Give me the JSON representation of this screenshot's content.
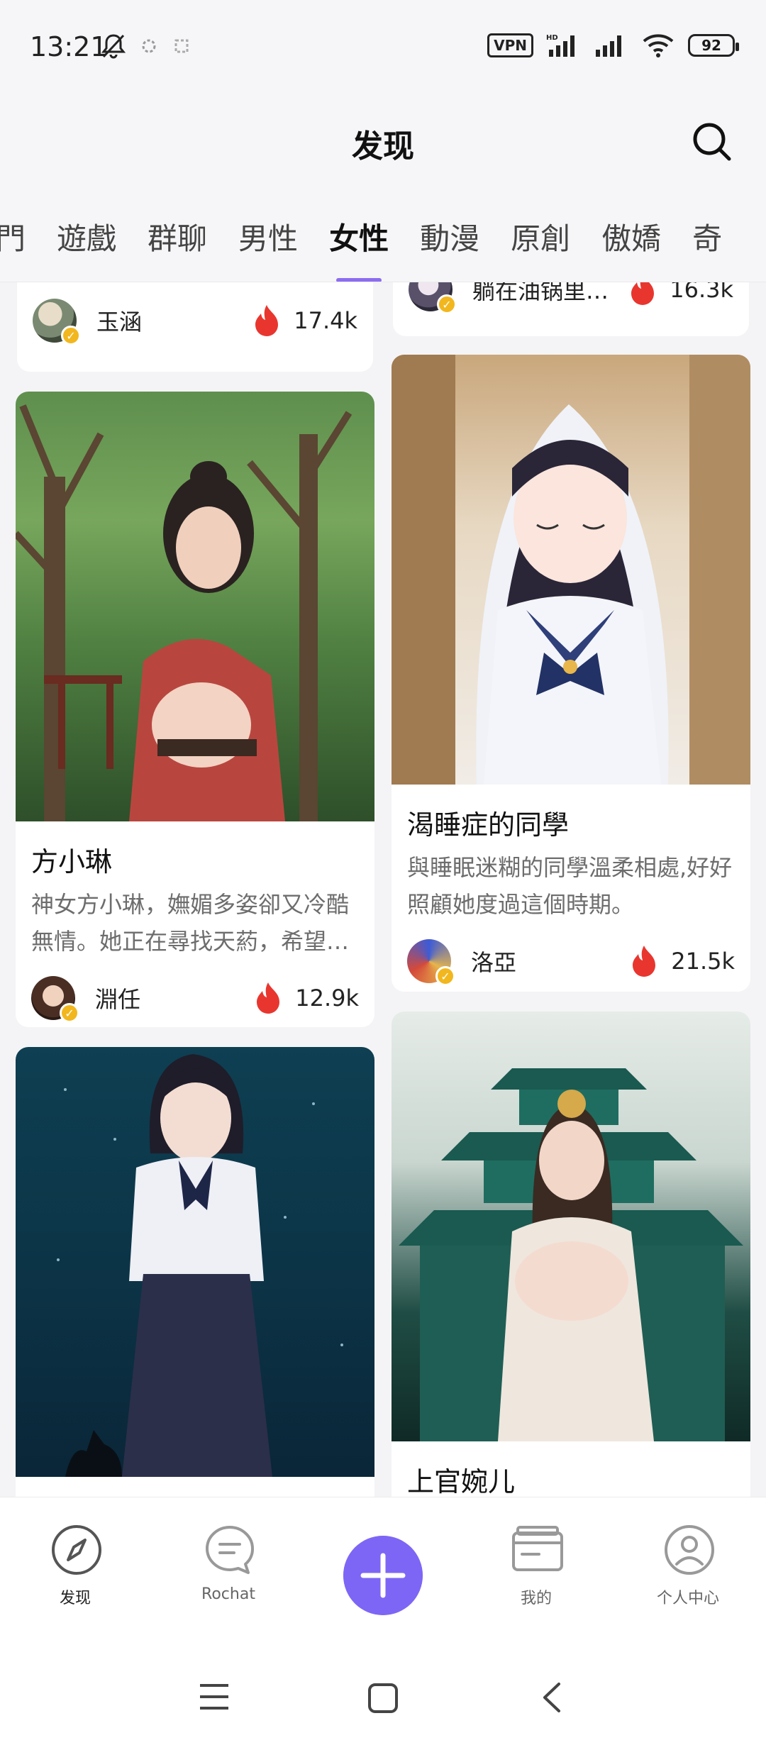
{
  "status_bar": {
    "time": "13:21",
    "vpn": "VPN",
    "battery": "92"
  },
  "header": {
    "title": "发现"
  },
  "tabs": [
    "門",
    "遊戲",
    "群聊",
    "男性",
    "女性",
    "動漫",
    "原創",
    "傲嬌",
    "奇"
  ],
  "active_tab": "女性",
  "cards": {
    "top_left": {
      "author": "玉涵",
      "likes": "17.4k"
    },
    "top_right": {
      "author": "躺在油锅里…",
      "likes": "16.3k"
    },
    "fang": {
      "title": "方小琳",
      "desc": "神女方小琳，嫵媚多姿卻又冷酷無情。她正在尋找天葯，希望…",
      "author": "淵任",
      "likes": "12.9k"
    },
    "sleepy": {
      "title": "渴睡症的同學",
      "desc": "與睡眠迷糊的同學溫柔相處,好好照顧她度過這個時期。",
      "author": "洛亞",
      "likes": "21.5k"
    },
    "shangguan": {
      "title": "上官婉儿"
    }
  },
  "bottom_nav": {
    "discover": "发现",
    "rochat": "Rochat",
    "mine": "我的",
    "profile": "个人中心"
  },
  "colors": {
    "accent": "#7d66f5",
    "tab_indicator": "#8b6cf0",
    "fire": "#e8362f",
    "verified": "#f2b71e"
  }
}
